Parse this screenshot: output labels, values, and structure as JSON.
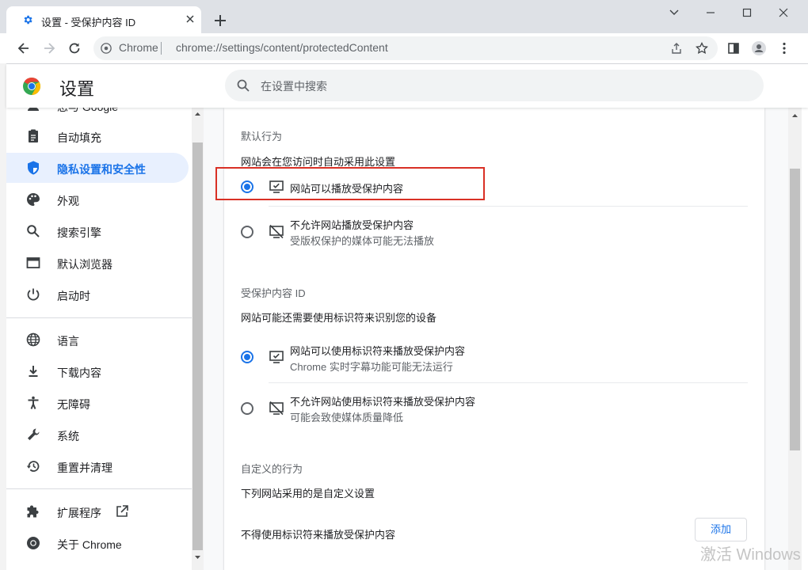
{
  "tab": {
    "title": "设置 - 受保护内容 ID"
  },
  "omnibox": {
    "site": "Chrome",
    "url": "chrome://settings/content/protectedContent"
  },
  "header": {
    "title": "设置",
    "search_placeholder": "在设置中搜索"
  },
  "sidebar": {
    "partial_item": "您与 Google",
    "items": [
      {
        "label": "自动填充",
        "icon": "clipboard-icon"
      },
      {
        "label": "隐私设置和安全性",
        "icon": "shield-icon",
        "active": true
      },
      {
        "label": "外观",
        "icon": "palette-icon"
      },
      {
        "label": "搜索引擎",
        "icon": "search-icon"
      },
      {
        "label": "默认浏览器",
        "icon": "browser-icon"
      },
      {
        "label": "启动时",
        "icon": "power-icon"
      },
      {
        "label": "语言",
        "icon": "globe-icon"
      },
      {
        "label": "下载内容",
        "icon": "download-icon"
      },
      {
        "label": "无障碍",
        "icon": "accessibility-icon"
      },
      {
        "label": "系统",
        "icon": "wrench-icon"
      },
      {
        "label": "重置并清理",
        "icon": "history-icon"
      },
      {
        "label": "扩展程序",
        "icon": "puzzle-icon"
      },
      {
        "label": "关于 Chrome",
        "icon": "chrome-icon"
      }
    ]
  },
  "content": {
    "default_title": "默认行为",
    "default_desc": "网站会在您访问时自动采用此设置",
    "opt1_title": "网站可以播放受保护内容",
    "opt2_title": "不允许网站播放受保护内容",
    "opt2_sub": "受版权保护的媒体可能无法播放",
    "id_title": "受保护内容 ID",
    "id_desc": "网站可能还需要使用标识符来识别您的设备",
    "opt3_title": "网站可以使用标识符来播放受保护内容",
    "opt3_sub": "Chrome 实时字幕功能可能无法运行",
    "opt4_title": "不允许网站使用标识符来播放受保护内容",
    "opt4_sub": "可能会致使媒体质量降低",
    "custom_title": "自定义的行为",
    "custom_desc": "下列网站采用的是自定义设置",
    "blocked_label": "不得使用标识符来播放受保护内容",
    "add_label": "添加"
  },
  "watermark": "激活 Windows",
  "colors": {
    "accent": "#1a73e8",
    "highlight": "#d93025",
    "active_bg": "#e8f0fe"
  }
}
